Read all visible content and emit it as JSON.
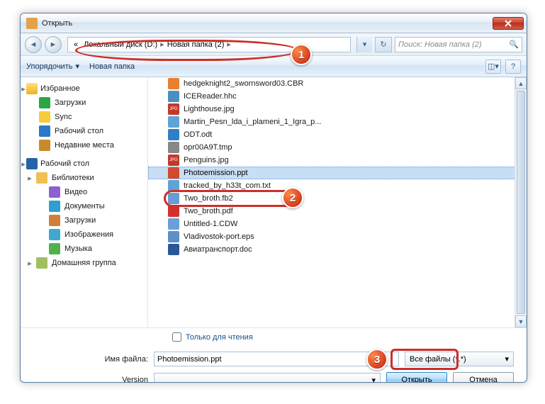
{
  "window_title": "Открыть",
  "breadcrumb": {
    "prefix": "«",
    "part1": "Локальный диск (D:)",
    "part2": "Новая папка (2)",
    "sep": "▸"
  },
  "search_placeholder": "Поиск: Новая папка (2)",
  "toolbar": {
    "organize": "Упорядочить",
    "new_folder": "Новая папка"
  },
  "sidebar": {
    "favorites": "Избранное",
    "downloads": "Загрузки",
    "sync": "Sync",
    "desktop": "Рабочий стол",
    "recent": "Недавние места",
    "desktop2": "Рабочий стол",
    "libraries": "Библиотеки",
    "video": "Видео",
    "documents": "Документы",
    "downloads2": "Загрузки",
    "images": "Изображения",
    "music": "Музыка",
    "homegroup": "Домашняя группа"
  },
  "files": [
    "hedgeknight2_swornsword03.CBR",
    "ICEReader.hhc",
    "Lighthouse.jpg",
    "Martin_Pesn_lda_i_plameni_1_Igra_p...",
    "ODT.odt",
    "opr00A9T.tmp",
    "Penguins.jpg",
    "Photoemission.ppt",
    "tracked_by_h33t_com.txt",
    "Two_broth.fb2",
    "Two_broth.pdf",
    "Untitled-1.CDW",
    "Vladivostok-port.eps",
    "Авиатранспорт.doc"
  ],
  "readonly_label": "Только для чтения",
  "filename_label": "Имя файла:",
  "filename_value": "Photoemission.ppt",
  "version_label": "Version",
  "filter_value": "Все файлы (*.*)",
  "open_btn": "Открыть",
  "cancel_btn": "Отмена",
  "callouts": {
    "n1": "1",
    "n2": "2",
    "n3": "3"
  }
}
